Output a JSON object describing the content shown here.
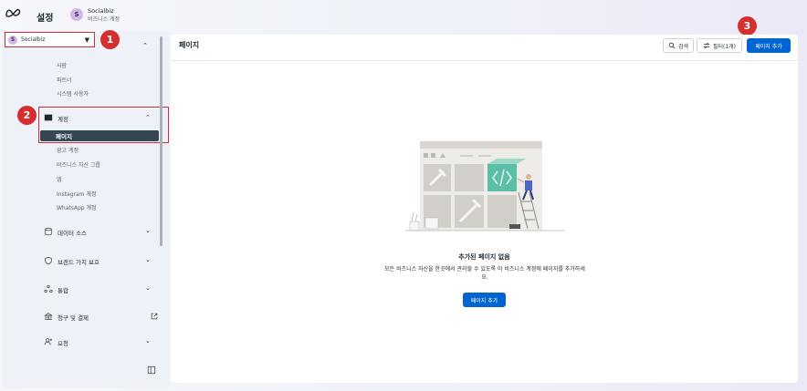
{
  "header": {
    "title": "설정",
    "business_initial": "S",
    "business_name": "Socialbiz",
    "business_sub": "비즈니스 계정"
  },
  "sidebar": {
    "business_selector": {
      "initial": "S",
      "name": "Socialbiz"
    },
    "users_items": [
      "사람",
      "파트너",
      "시스템 사용자"
    ],
    "accounts": {
      "label": "계정",
      "active_item": "페이지",
      "items": [
        "광고 계정",
        "비즈니스 자산 그룹",
        "앱",
        "Instagram 계정",
        "WhatsApp 계정"
      ]
    },
    "sections": [
      {
        "label": "데이터 소스"
      },
      {
        "label": "브랜드 가치 보호"
      },
      {
        "label": "통합"
      },
      {
        "label": "청구 및 결제"
      },
      {
        "label": "요청"
      }
    ]
  },
  "badges": [
    "1",
    "2",
    "3"
  ],
  "main": {
    "title": "페이지",
    "search_label": "검색",
    "filter_label": "필터(1개)",
    "add_page_label": "페이지 추가",
    "empty_title": "추가된 페이지 없음",
    "empty_desc": "모든 비즈니스 자산을 한곳에서 관리할 수 있도록 이 비즈니스 계정에 페이지를 추가하세요.",
    "empty_button": "페이지 추가"
  },
  "colors": {
    "accent": "#0064d1",
    "annotation_red": "#d32f2f",
    "active_nav": "#344854",
    "illustration_teal": "#5bbfa8"
  }
}
